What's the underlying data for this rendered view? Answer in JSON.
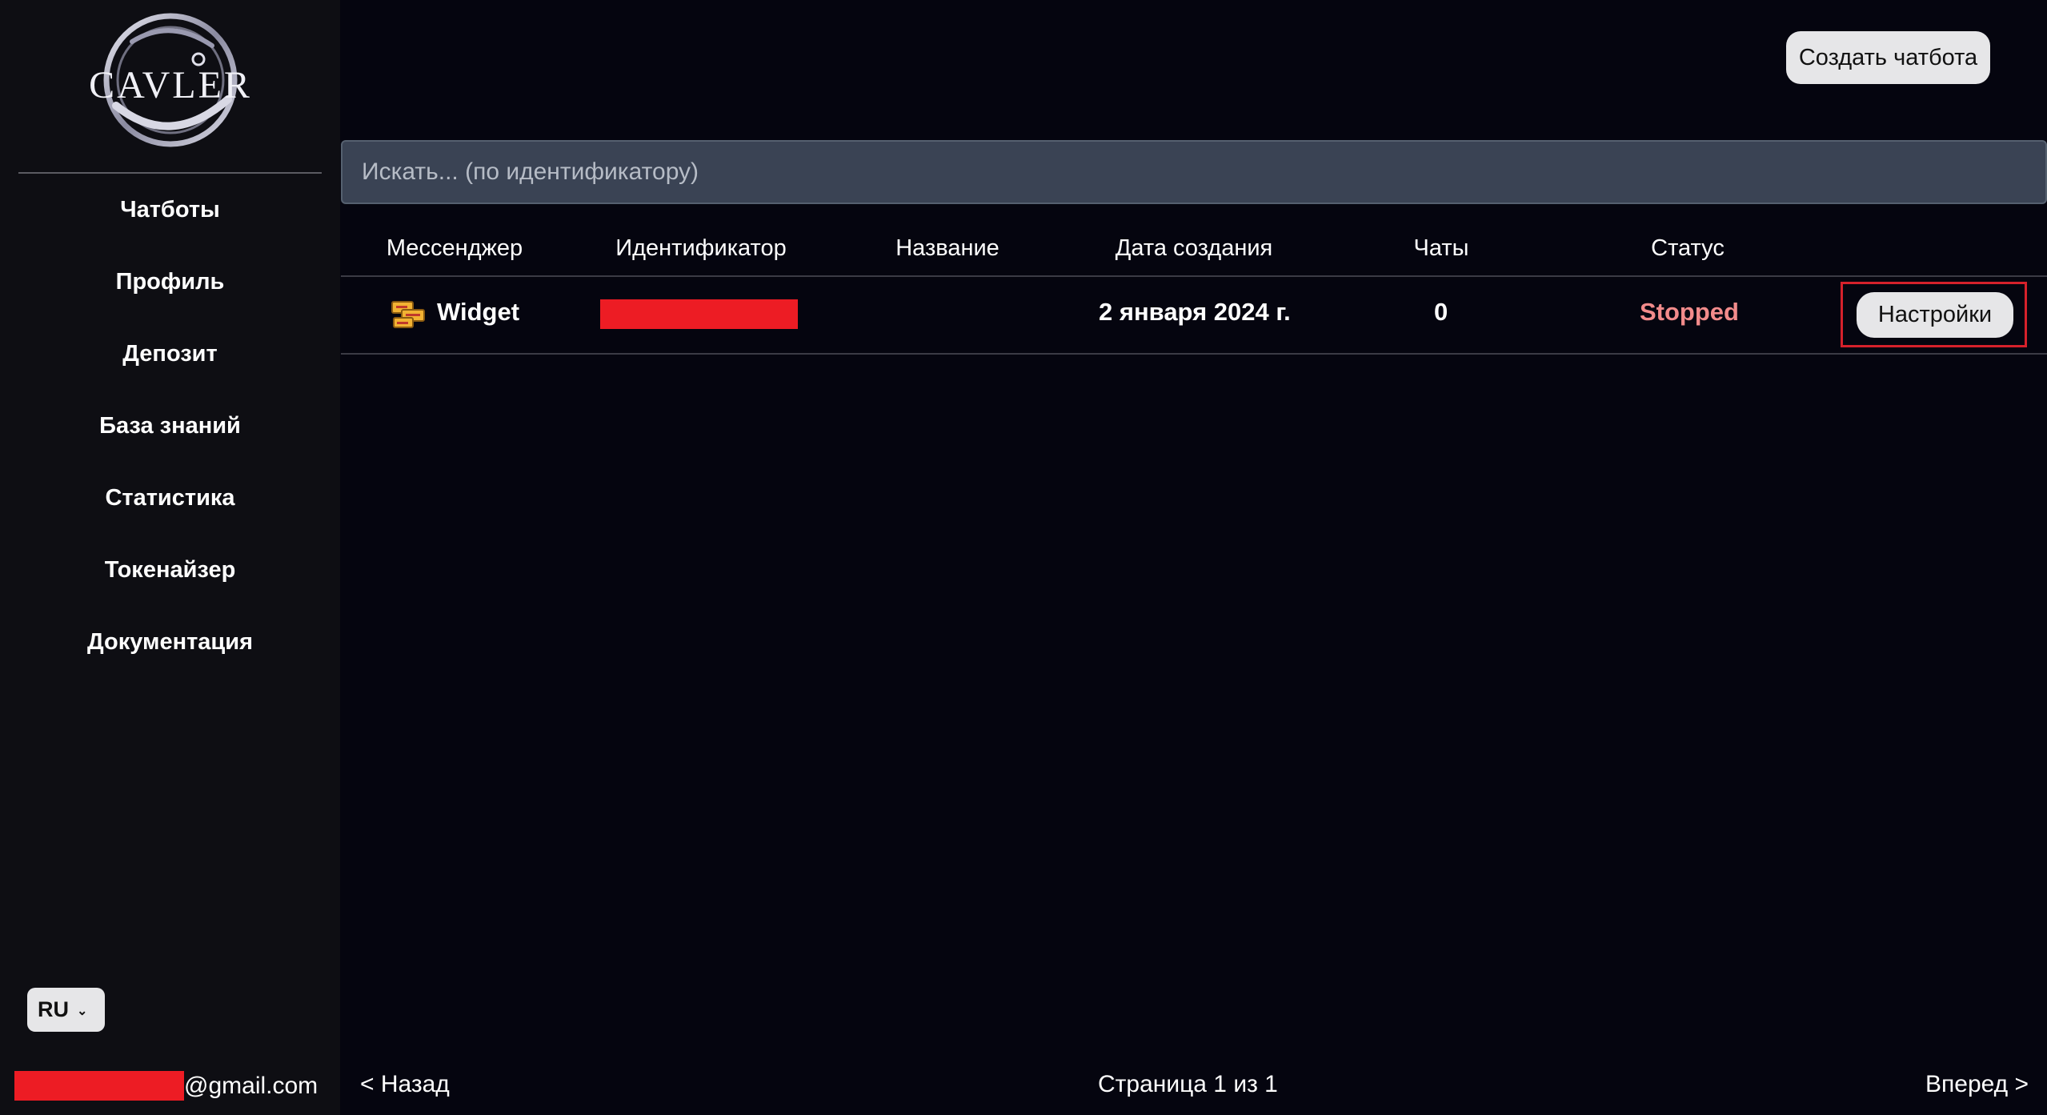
{
  "sidebar": {
    "logo_text": "CAVLER",
    "nav": [
      {
        "label": "Чатботы"
      },
      {
        "label": "Профиль"
      },
      {
        "label": "Депозит"
      },
      {
        "label": "База знаний"
      },
      {
        "label": "Статистика"
      },
      {
        "label": "Токенайзер"
      },
      {
        "label": "Документация"
      }
    ],
    "language": "RU",
    "email_suffix": "@gmail.com"
  },
  "header": {
    "create_label": "Создать чатбота"
  },
  "search": {
    "placeholder": "Искать... (по идентификатору)",
    "value": ""
  },
  "table": {
    "columns": [
      "Мессенджер",
      "Идентификатор",
      "Название",
      "Дата создания",
      "Чаты",
      "Статус"
    ],
    "rows": [
      {
        "messenger": "Widget",
        "messenger_icon": "widget-chat-icon",
        "identifier": "",
        "name": "",
        "created": "2 января 2024 г.",
        "chats": "0",
        "status": "Stopped",
        "action": "Настройки"
      }
    ]
  },
  "pagination": {
    "prev": "< Назад",
    "info": "Страница 1 из 1",
    "next": "Вперед >"
  },
  "colors": {
    "background": "#05050f",
    "sidebar": "#0e0e13",
    "search_bg": "#3a4354",
    "status_stopped": "#f28b8b",
    "highlight": "#d6212b",
    "redaction": "#ed1c24"
  }
}
